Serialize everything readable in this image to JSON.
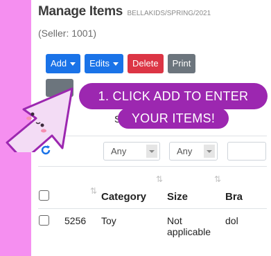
{
  "page": {
    "title": "Manage Items",
    "path": "BELLAKIDS/SPRING/2021",
    "seller": "(Seller: 1001)"
  },
  "toolbar": {
    "add_label": "Add",
    "edits_label": "Edits",
    "delete_label": "Delete",
    "print_label": "Print"
  },
  "show_label": "Show",
  "callout": {
    "line1": "1. CLICK ADD TO ENTER",
    "line2": "YOUR ITEMS!"
  },
  "table": {
    "filters": [
      "Any",
      "Any"
    ],
    "headers": [
      "Category",
      "Size",
      "Bra"
    ],
    "rows": [
      {
        "id": "5256",
        "category": "Toy",
        "size_line1": "Not",
        "size_line2": "applicable",
        "brand": "dol"
      }
    ]
  },
  "colors": {
    "background": "#f58ff0",
    "callout": "#9c27b0",
    "primary": "#1a73e8",
    "danger": "#dc3545",
    "secondary": "#6c757d"
  }
}
